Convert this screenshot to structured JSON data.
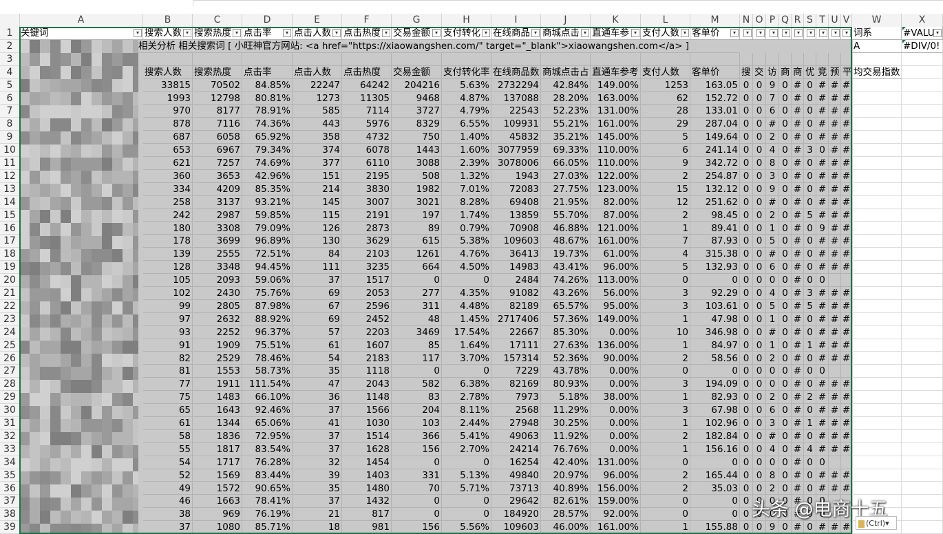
{
  "columns": [
    "A",
    "B",
    "C",
    "D",
    "E",
    "F",
    "G",
    "H",
    "I",
    "J",
    "K",
    "L",
    "M",
    "N",
    "O",
    "P",
    "Q",
    "R",
    "S",
    "T",
    "U",
    "V",
    "W",
    "X"
  ],
  "row_numbers": [
    "1",
    "2",
    "3",
    "4",
    "5",
    "6",
    "7",
    "8",
    "9",
    "10",
    "11",
    "12",
    "13",
    "14",
    "15",
    "16",
    "17",
    "18",
    "19",
    "20",
    "21",
    "22",
    "23",
    "24",
    "25",
    "26",
    "27",
    "28",
    "29",
    "30",
    "31",
    "32",
    "33",
    "34",
    "35",
    "36",
    "37",
    "38",
    "39"
  ],
  "row1_headers": [
    "关键词",
    "搜索人数",
    "搜索热度",
    "点击率",
    "点击人数",
    "点击热度",
    "交易金额",
    "支付转化",
    "在线商品",
    "商城点击",
    "直通车参",
    "支付人数",
    "客单价",
    "",
    "",
    "",
    "",
    "",
    "",
    "",
    "",
    "",
    "词系",
    "#VALU"
  ],
  "row2": {
    "text": "相关分析 相关搜索词 [ 小旺神官方网站: <a href=\"https://xiaowangshen.com/\" target=\"_blank\">xiaowangshen.com</a> ]",
    "w": "A",
    "x": "#DIV/0!"
  },
  "row4_headers": [
    "搜索人数",
    "搜索热度",
    "点击率",
    "点击人数",
    "点击热度",
    "交易金额",
    "支付转化率",
    "在线商品数",
    "商城点击占",
    "直通车参考",
    "支付人数",
    "客单价",
    "搜",
    "交",
    "访",
    "商",
    "商",
    "优",
    "竞",
    "预",
    "平"
  ],
  "row4_w": "均交易指数",
  "rows": [
    [
      "33815",
      "70502",
      "84.85%",
      "22247",
      "64242",
      "204216",
      "5.63%",
      "2732294",
      "42.84%",
      "149.00%",
      "1253",
      "163.05",
      "0",
      "0",
      "9",
      "0",
      "#",
      "0",
      "#",
      "#"
    ],
    [
      "1993",
      "12798",
      "80.81%",
      "1273",
      "11305",
      "9468",
      "4.87%",
      "137088",
      "28.20%",
      "163.00%",
      "62",
      "152.72",
      "0",
      "0",
      "7",
      "0",
      "#",
      "0",
      "#",
      "#"
    ],
    [
      "970",
      "8177",
      "78.91%",
      "585",
      "7114",
      "3727",
      "4.79%",
      "22543",
      "52.23%",
      "131.00%",
      "28",
      "133.01",
      "0",
      "0",
      "6",
      "0",
      "#",
      "0",
      "#",
      "#"
    ],
    [
      "878",
      "7116",
      "74.36%",
      "443",
      "5976",
      "8329",
      "6.55%",
      "109931",
      "55.21%",
      "161.00%",
      "29",
      "287.04",
      "0",
      "0",
      "#",
      "0",
      "#",
      "0",
      "#",
      "#"
    ],
    [
      "687",
      "6058",
      "65.92%",
      "358",
      "4732",
      "750",
      "1.40%",
      "45832",
      "35.21%",
      "145.00%",
      "5",
      "149.64",
      "0",
      "0",
      "2",
      "0",
      "#",
      "0",
      "#",
      "#"
    ],
    [
      "653",
      "6967",
      "79.34%",
      "374",
      "6078",
      "1443",
      "1.60%",
      "3077959",
      "69.33%",
      "110.00%",
      "6",
      "241.14",
      "0",
      "0",
      "4",
      "0",
      "#",
      "3",
      "0",
      "#"
    ],
    [
      "621",
      "7257",
      "74.69%",
      "377",
      "6110",
      "3088",
      "2.39%",
      "3078006",
      "66.05%",
      "110.00%",
      "9",
      "342.72",
      "0",
      "0",
      "8",
      "0",
      "#",
      "0",
      "#",
      "#"
    ],
    [
      "360",
      "3653",
      "42.96%",
      "151",
      "2195",
      "508",
      "1.32%",
      "1943",
      "27.03%",
      "122.00%",
      "2",
      "254.87",
      "0",
      "0",
      "3",
      "0",
      "#",
      "0",
      "#",
      "#"
    ],
    [
      "334",
      "4209",
      "85.35%",
      "214",
      "3830",
      "1982",
      "7.01%",
      "72083",
      "27.75%",
      "123.00%",
      "15",
      "132.12",
      "0",
      "0",
      "9",
      "0",
      "#",
      "0",
      "#",
      "#"
    ],
    [
      "258",
      "3137",
      "93.21%",
      "145",
      "3007",
      "3021",
      "8.28%",
      "69408",
      "21.95%",
      "82.00%",
      "12",
      "251.62",
      "0",
      "0",
      "#",
      "0",
      "#",
      "0",
      "#",
      "#"
    ],
    [
      "242",
      "2987",
      "59.85%",
      "115",
      "2191",
      "197",
      "1.74%",
      "13859",
      "55.70%",
      "87.00%",
      "2",
      "98.45",
      "0",
      "0",
      "2",
      "0",
      "#",
      "5",
      "#",
      "#"
    ],
    [
      "180",
      "3308",
      "79.09%",
      "126",
      "2873",
      "89",
      "0.79%",
      "70908",
      "46.88%",
      "121.00%",
      "1",
      "89.41",
      "0",
      "0",
      "1",
      "0",
      "#",
      "0",
      "9",
      "#"
    ],
    [
      "178",
      "3699",
      "96.89%",
      "130",
      "3629",
      "615",
      "5.38%",
      "109603",
      "48.67%",
      "161.00%",
      "7",
      "87.93",
      "0",
      "0",
      "5",
      "0",
      "#",
      "0",
      "#",
      "#"
    ],
    [
      "139",
      "2555",
      "72.51%",
      "84",
      "2103",
      "1261",
      "4.76%",
      "36413",
      "19.73%",
      "61.00%",
      "4",
      "315.38",
      "0",
      "0",
      "#",
      "0",
      "#",
      "0",
      "#",
      "#"
    ],
    [
      "128",
      "3348",
      "94.45%",
      "111",
      "3235",
      "664",
      "4.50%",
      "14983",
      "43.41%",
      "96.00%",
      "5",
      "132.93",
      "0",
      "0",
      "6",
      "0",
      "#",
      "0",
      "#",
      "#"
    ],
    [
      "105",
      "2093",
      "59.06%",
      "37",
      "1517",
      "0",
      "0",
      "2484",
      "74.26%",
      "113.00%",
      "0",
      "0",
      "0",
      "0",
      "0",
      "0",
      "#",
      "0",
      "0",
      ""
    ],
    [
      "102",
      "2430",
      "75.76%",
      "69",
      "2053",
      "277",
      "4.35%",
      "91082",
      "43.26%",
      "56.00%",
      "3",
      "92.29",
      "0",
      "0",
      "4",
      "0",
      "#",
      "3",
      "#",
      "#"
    ],
    [
      "99",
      "2805",
      "87.98%",
      "67",
      "2596",
      "311",
      "4.48%",
      "82189",
      "65.57%",
      "95.00%",
      "3",
      "103.61",
      "0",
      "0",
      "5",
      "0",
      "#",
      "5",
      "#",
      "#"
    ],
    [
      "97",
      "2632",
      "88.92%",
      "69",
      "2452",
      "48",
      "1.45%",
      "2717406",
      "57.36%",
      "149.00%",
      "1",
      "47.98",
      "0",
      "0",
      "1",
      "0",
      "#",
      "0",
      "#",
      "#"
    ],
    [
      "93",
      "2252",
      "96.37%",
      "57",
      "2203",
      "3469",
      "17.54%",
      "22667",
      "85.30%",
      "0.00%",
      "10",
      "346.98",
      "0",
      "0",
      "#",
      "0",
      "#",
      "0",
      "#",
      "#"
    ],
    [
      "91",
      "1909",
      "75.51%",
      "61",
      "1607",
      "85",
      "1.64%",
      "17111",
      "27.63%",
      "136.00%",
      "1",
      "84.97",
      "0",
      "0",
      "1",
      "0",
      "#",
      "1",
      "#",
      "#"
    ],
    [
      "82",
      "2529",
      "78.46%",
      "54",
      "2183",
      "117",
      "3.70%",
      "157314",
      "52.36%",
      "90.00%",
      "2",
      "58.56",
      "0",
      "0",
      "2",
      "0",
      "#",
      "0",
      "#",
      "#"
    ],
    [
      "81",
      "1553",
      "58.73%",
      "35",
      "1118",
      "0",
      "0",
      "7229",
      "43.78%",
      "0.00%",
      "0",
      "0",
      "0",
      "0",
      "0",
      "0",
      "#",
      "0",
      "0",
      ""
    ],
    [
      "77",
      "1911",
      "111.54%",
      "47",
      "2043",
      "582",
      "6.38%",
      "82169",
      "80.93%",
      "0.00%",
      "3",
      "194.09",
      "0",
      "0",
      "0",
      "0",
      "#",
      "0",
      "#",
      "#"
    ],
    [
      "75",
      "1483",
      "66.10%",
      "36",
      "1148",
      "83",
      "2.78%",
      "7973",
      "5.18%",
      "38.00%",
      "1",
      "82.93",
      "0",
      "0",
      "2",
      "0",
      "#",
      "2",
      "#",
      "#"
    ],
    [
      "65",
      "1643",
      "92.46%",
      "37",
      "1566",
      "204",
      "8.11%",
      "2568",
      "11.29%",
      "0.00%",
      "3",
      "67.98",
      "0",
      "0",
      "6",
      "0",
      "#",
      "0",
      "#",
      "#"
    ],
    [
      "61",
      "1344",
      "65.06%",
      "41",
      "1030",
      "103",
      "2.44%",
      "27948",
      "30.25%",
      "0.00%",
      "1",
      "102.96",
      "0",
      "0",
      "3",
      "0",
      "#",
      "1",
      "#",
      "#"
    ],
    [
      "58",
      "1836",
      "72.95%",
      "37",
      "1514",
      "366",
      "5.41%",
      "49063",
      "11.92%",
      "0.00%",
      "2",
      "182.84",
      "0",
      "0",
      "#",
      "0",
      "#",
      "0",
      "#",
      "#"
    ],
    [
      "55",
      "1817",
      "83.54%",
      "37",
      "1628",
      "156",
      "2.70%",
      "24214",
      "76.76%",
      "0.00%",
      "1",
      "156.16",
      "0",
      "0",
      "4",
      "0",
      "#",
      "4",
      "#",
      "#"
    ],
    [
      "54",
      "1717",
      "76.28%",
      "32",
      "1454",
      "0",
      "0",
      "16254",
      "42.40%",
      "131.00%",
      "0",
      "0",
      "0",
      "0",
      "0",
      "0",
      "#",
      "0",
      "0",
      ""
    ],
    [
      "52",
      "1569",
      "83.44%",
      "39",
      "1403",
      "331",
      "5.13%",
      "49840",
      "20.97%",
      "96.00%",
      "2",
      "165.44",
      "0",
      "0",
      "8",
      "0",
      "#",
      "0",
      "#",
      "#"
    ],
    [
      "49",
      "1572",
      "90.65%",
      "35",
      "1480",
      "70",
      "5.71%",
      "73713",
      "40.89%",
      "156.00%",
      "2",
      "35.03",
      "0",
      "0",
      "2",
      "0",
      "#",
      "0",
      "#",
      "#"
    ],
    [
      "46",
      "1663",
      "78.41%",
      "37",
      "1432",
      "0",
      "0",
      "29642",
      "82.61%",
      "159.00%",
      "0",
      "0",
      "0",
      "0",
      "0",
      "0",
      "#",
      "0",
      "0",
      ""
    ],
    [
      "38",
      "969",
      "76.19%",
      "21",
      "817",
      "0",
      "0",
      "184920",
      "28.57%",
      "92.00%",
      "0",
      "0",
      "0",
      "0",
      "0",
      "0",
      "#",
      "0",
      "0",
      ""
    ],
    [
      "37",
      "1080",
      "85.71%",
      "18",
      "981",
      "156",
      "5.56%",
      "109603",
      "46.00%",
      "161.00%",
      "1",
      "155.88",
      "0",
      "0",
      "9",
      "0",
      "#",
      "0",
      "#",
      "#"
    ]
  ],
  "watermark": "头条 @电商十五",
  "paste_label": "(Ctrl)",
  "colors": {
    "selection": "#1e7145",
    "highlight": "#c9c9c9"
  }
}
